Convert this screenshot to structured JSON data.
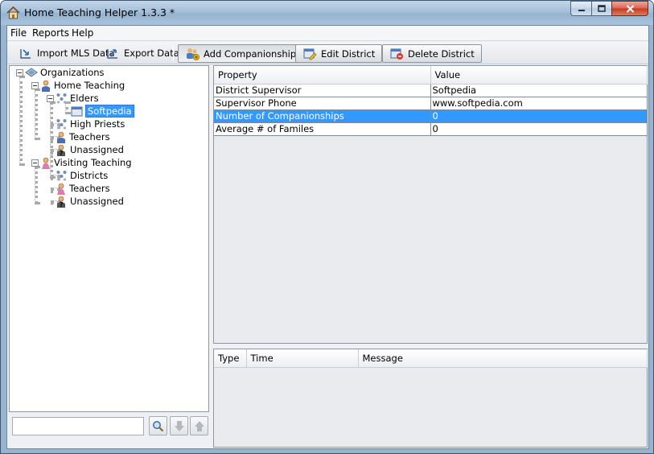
{
  "window": {
    "title": "Home Teaching Helper 1.3.3 *",
    "controls": [
      "minimize",
      "maximize",
      "close"
    ]
  },
  "menu": [
    "File",
    "Reports",
    "Help"
  ],
  "toolbar": {
    "import_label": "Import MLS Data",
    "export_label": "Export Data",
    "add_companionship_label": "Add Companionship",
    "edit_district_label": "Edit District",
    "delete_district_label": "Delete District"
  },
  "tree": {
    "root": "Organizations",
    "home_teaching": "Home Teaching",
    "elders": "Elders",
    "softpedia": "Softpedia",
    "high_priests": "High Priests",
    "ht_teachers": "Teachers",
    "ht_unassigned": "Unassigned",
    "visiting_teaching": "Visiting Teaching",
    "districts": "Districts",
    "vt_teachers": "Teachers",
    "vt_unassigned": "Unassigned",
    "selected": "Softpedia"
  },
  "search": {
    "value": ""
  },
  "properties": {
    "headers": [
      "Property",
      "Value"
    ],
    "rows": [
      {
        "property": "District Supervisor",
        "value": "Softpedia"
      },
      {
        "property": "Supervisor Phone",
        "value": "www.softpedia.com"
      },
      {
        "property": "Number of Companionships",
        "value": "0",
        "selected": true
      },
      {
        "property": "Average # of Familes",
        "value": "0"
      }
    ]
  },
  "messages": {
    "headers": [
      "Type",
      "Time",
      "Message"
    ]
  },
  "colors": {
    "selection": "#3399ff",
    "close_button": "#c4391f"
  }
}
